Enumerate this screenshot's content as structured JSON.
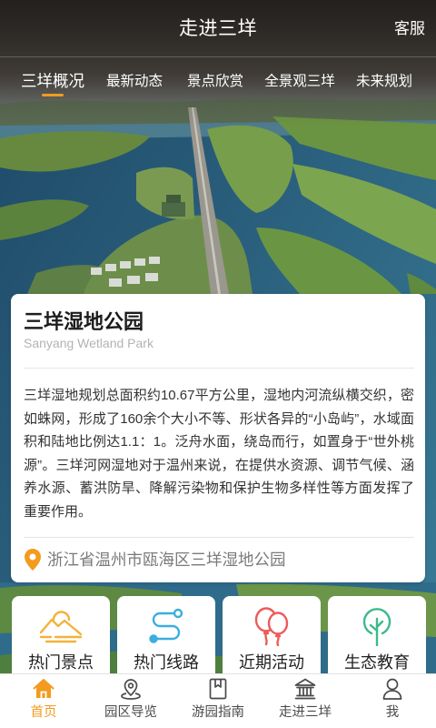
{
  "header": {
    "title": "走进三垟",
    "service_label": "客服"
  },
  "tabs": [
    {
      "label": "三垟概况",
      "active": true
    },
    {
      "label": "最新动态",
      "active": false
    },
    {
      "label": "景点欣赏",
      "active": false
    },
    {
      "label": "全景观三垟",
      "active": false
    },
    {
      "label": "未来规划",
      "active": false
    }
  ],
  "intro_card": {
    "title": "三垟湿地公园",
    "subtitle": "Sanyang Wetland Park",
    "description": "三垟湿地规划总面积约10.67平方公里，湿地内河流纵横交织，密如蛛网，形成了160余个大小不等、形状各异的“小岛屿”，水域面积和陆地比例达1.1：1。泛舟水面，绕岛而行，如置身于“世外桃源”。三垟河网湿地对于温州来说，在提供水资源、调节气候、涵养水源、蓄洪防旱、降解污染物和保护生物多样性等方面发挥了重要作用。",
    "location_icon": "location-pin-icon",
    "address": "浙江省温州市瓯海区三垟湿地公园"
  },
  "shortcuts": [
    {
      "label": "热门景点",
      "icon": "mountain-sun-icon",
      "color": "#F5B13A"
    },
    {
      "label": "热门线路",
      "icon": "route-icon",
      "color": "#3AAEE0"
    },
    {
      "label": "近期活动",
      "icon": "balloons-icon",
      "color": "#EE5A5A"
    },
    {
      "label": "生态教育",
      "icon": "tree-icon",
      "color": "#3DB98B"
    }
  ],
  "bottom_nav": [
    {
      "label": "首页",
      "icon": "home-icon",
      "active": true
    },
    {
      "label": "园区导览",
      "icon": "map-pin-icon",
      "active": false
    },
    {
      "label": "游园指南",
      "icon": "book-icon",
      "active": false
    },
    {
      "label": "走进三垟",
      "icon": "landmark-icon",
      "active": false
    },
    {
      "label": "我",
      "icon": "user-icon",
      "active": false
    }
  ],
  "colors": {
    "accent": "#F29B1F",
    "nav_inactive": "#4A4A4A"
  }
}
